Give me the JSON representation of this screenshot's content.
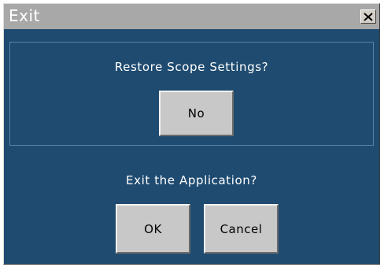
{
  "window": {
    "title": "Exit",
    "close_icon": "close-x-icon"
  },
  "restore_section": {
    "question": "Restore Scope Settings?",
    "no_label": "No"
  },
  "exit_section": {
    "question": "Exit the Application?",
    "ok_label": "OK",
    "cancel_label": "Cancel"
  },
  "colors": {
    "background": "#1f4b70",
    "titlebar": "#a8a8a8",
    "button_face": "#c8c8c8"
  }
}
